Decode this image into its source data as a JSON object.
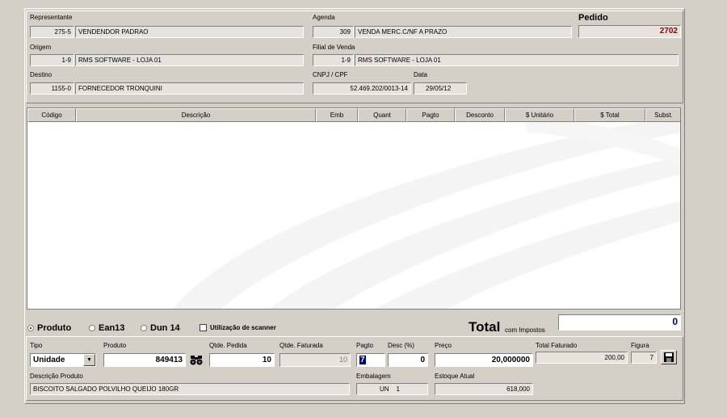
{
  "header": {
    "representante": {
      "label": "Representante",
      "code": "275-5",
      "name": "VENDENDOR PADRAO"
    },
    "agenda": {
      "label": "Agenda",
      "code": "309",
      "name": "VENDA MERC.C/NF A PRAZO"
    },
    "pedido": {
      "label": "Pedido",
      "value": "2702"
    },
    "origem": {
      "label": "Origem",
      "code": "1-9",
      "name": "RMS SOFTWARE - LOJA 01"
    },
    "filial": {
      "label": "Filial de Venda",
      "code": "1-9",
      "name": "RMS SOFTWARE - LOJA 01"
    },
    "destino": {
      "label": "Destino",
      "code": "1155-0",
      "name": "FORNECEDOR TRONQUINI"
    },
    "cnpj": {
      "label": "CNPJ / CPF",
      "value": "52.469.202/0013-14"
    },
    "data": {
      "label": "Data",
      "value": "29/05/12"
    }
  },
  "grid": {
    "columns": [
      "Código",
      "Descrição",
      "Emb",
      "Quant",
      "Pagto",
      "Desconto",
      "$ Unitário",
      "$ Total",
      "Subst."
    ],
    "rows": []
  },
  "options": {
    "produto": "Produto",
    "ean13": "Ean13",
    "dun14": "Dun 14",
    "scanner": "Utilização de scanner",
    "selected": "produto"
  },
  "total": {
    "label": "Total",
    "sublabel": "com Impostos",
    "value": "0"
  },
  "item": {
    "tipo_label": "Tipo",
    "tipo_value": "Unidade",
    "produto_label": "Produto",
    "produto_value": "849413",
    "qtde_pedida_label": "Qtde. Pedida",
    "qtde_pedida_value": "10",
    "qtde_faturada_label": "Qtde. Faturada",
    "qtde_faturada_value": "10",
    "pagto_label": "Pagto",
    "pagto_value": "7",
    "desc_label": "Desc (%)",
    "desc_value": "0",
    "preco_label": "Preço",
    "preco_value": "20,000000",
    "total_faturado_label": "Total Faturado",
    "total_faturado_value": "200,00",
    "figura_label": "Figura",
    "figura_value": "7",
    "descricao_label": "Descrição Produto",
    "descricao_value": "BISCOITO SALGADO POLVILHO QUEIJO 180GR",
    "embalagem_label": "Embalagem",
    "embalagem_value": "UN    1",
    "estoque_label": "Estoque Atual",
    "estoque_value": "618,000"
  },
  "colors": {
    "pedido": "#8b0000",
    "total": "#000080",
    "window": "#d4d0c8"
  },
  "icons": {
    "search": "binoculars-icon",
    "save": "floppy-disk-icon",
    "dropdown": "chevron-down-icon"
  }
}
